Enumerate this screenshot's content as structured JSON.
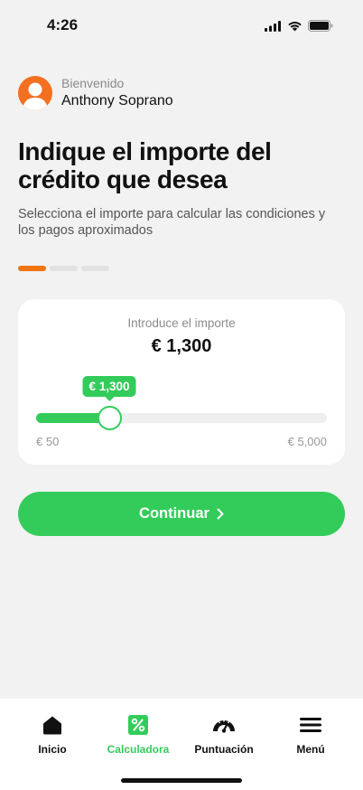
{
  "status": {
    "time": "4:26"
  },
  "user": {
    "welcome": "Bienvenido",
    "name": "Anthony Soprano"
  },
  "title": "Indique el importe del crédito que desea",
  "subtitle": "Selecciona el importe para calcular las condiciones y los pagos aproximados",
  "progress": {
    "current_step": 1,
    "total_steps": 3
  },
  "card": {
    "label": "Introduce el importe",
    "amount": "€ 1,300",
    "tooltip": "€ 1,300",
    "min_label": "€ 50",
    "max_label": "€ 5,000",
    "slider": {
      "min": 50,
      "max": 5000,
      "value": 1300
    }
  },
  "cta": {
    "label": "Continuar"
  },
  "tabs": [
    {
      "label": "Inicio",
      "icon": "home-icon"
    },
    {
      "label": "Calculadora",
      "icon": "percent-icon",
      "active": true
    },
    {
      "label": "Puntuación",
      "icon": "speedometer-icon"
    },
    {
      "label": "Menú",
      "icon": "hamburger-menu-icon"
    }
  ],
  "colors": {
    "accent": "#33cc5a",
    "brand_orange": "#f37021",
    "step_active": "#ef7611"
  }
}
